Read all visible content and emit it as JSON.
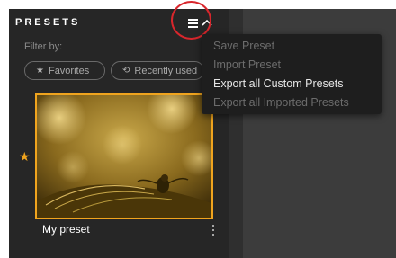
{
  "panel": {
    "title": "PRESETS",
    "filter_label": "Filter by:",
    "filters": [
      {
        "label": "Favorites",
        "icon": "star-icon"
      },
      {
        "label": "Recently used",
        "icon": "history-icon"
      }
    ],
    "accent_color": "#f0a41e"
  },
  "presets": [
    {
      "name": "My preset",
      "favorite": true,
      "selected": true
    }
  ],
  "menu": {
    "items": [
      {
        "label": "Save Preset",
        "enabled": false
      },
      {
        "label": "Import Preset",
        "enabled": false
      },
      {
        "label": "Export all Custom Presets",
        "enabled": true
      },
      {
        "label": "Export all Imported Presets",
        "enabled": false
      }
    ]
  }
}
